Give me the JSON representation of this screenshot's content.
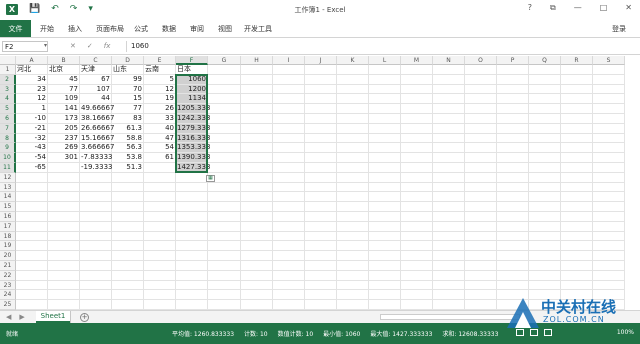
{
  "title": "工作簿1 - Excel",
  "qat": {
    "logo": "X",
    "save": "💾",
    "undo": "↶",
    "redo": "↷",
    "customize": "▾"
  },
  "winctl": {
    "help": "?",
    "restore": "⧉",
    "minimize": "—",
    "maximize": "□",
    "close": "✕"
  },
  "tabs": [
    "文件",
    "开始",
    "插入",
    "页面布局",
    "公式",
    "数据",
    "审阅",
    "视图",
    "开发工具"
  ],
  "signin": "登录",
  "namebox": "F2",
  "formula_value": "1060",
  "fx_icons": {
    "cancel": "✕",
    "enter": "✓",
    "fx": "fx"
  },
  "columns": [
    "A",
    "B",
    "C",
    "D",
    "E",
    "F",
    "G",
    "H",
    "I",
    "J",
    "K",
    "L",
    "M",
    "N",
    "O",
    "P",
    "Q",
    "R",
    "S"
  ],
  "headers": [
    "河北",
    "北京",
    "天津",
    "山东",
    "云南",
    "日本"
  ],
  "rows": [
    [
      "34",
      "45",
      "67",
      "99",
      "5",
      "1060"
    ],
    [
      "23",
      "77",
      "107",
      "70",
      "12",
      "1200"
    ],
    [
      "12",
      "109",
      "44",
      "15",
      "19",
      "1134"
    ],
    [
      "1",
      "141",
      "49.66667",
      "77",
      "26",
      "1205.333"
    ],
    [
      "-10",
      "173",
      "38.16667",
      "83",
      "33",
      "1242.333"
    ],
    [
      "-21",
      "205",
      "26.66667",
      "61.3",
      "40",
      "1279.333"
    ],
    [
      "-32",
      "237",
      "15.16667",
      "58.8",
      "47",
      "1316.333"
    ],
    [
      "-43",
      "269",
      "3.666667",
      "56.3",
      "54",
      "1353.333"
    ],
    [
      "-54",
      "301",
      "-7.83333",
      "53.8",
      "61",
      "1390.333"
    ],
    [
      "-65",
      "",
      "-19.3333",
      "51.3",
      "",
      "1427.333"
    ]
  ],
  "sheet": "Sheet1",
  "status": {
    "ready": "就绪",
    "average": "平均值: 1260.833333",
    "count": "计数: 10",
    "numcount": "数值计数: 10",
    "min": "最小值: 1060",
    "max": "最大值: 1427.333333",
    "sum": "求和: 12608.33333",
    "zoom": "100%"
  },
  "watermark": {
    "main": "中关村在线",
    "sub": "ZOL.COM.CN"
  },
  "colors": {
    "accent": "#217346",
    "watermark": "#1a6fb5"
  }
}
